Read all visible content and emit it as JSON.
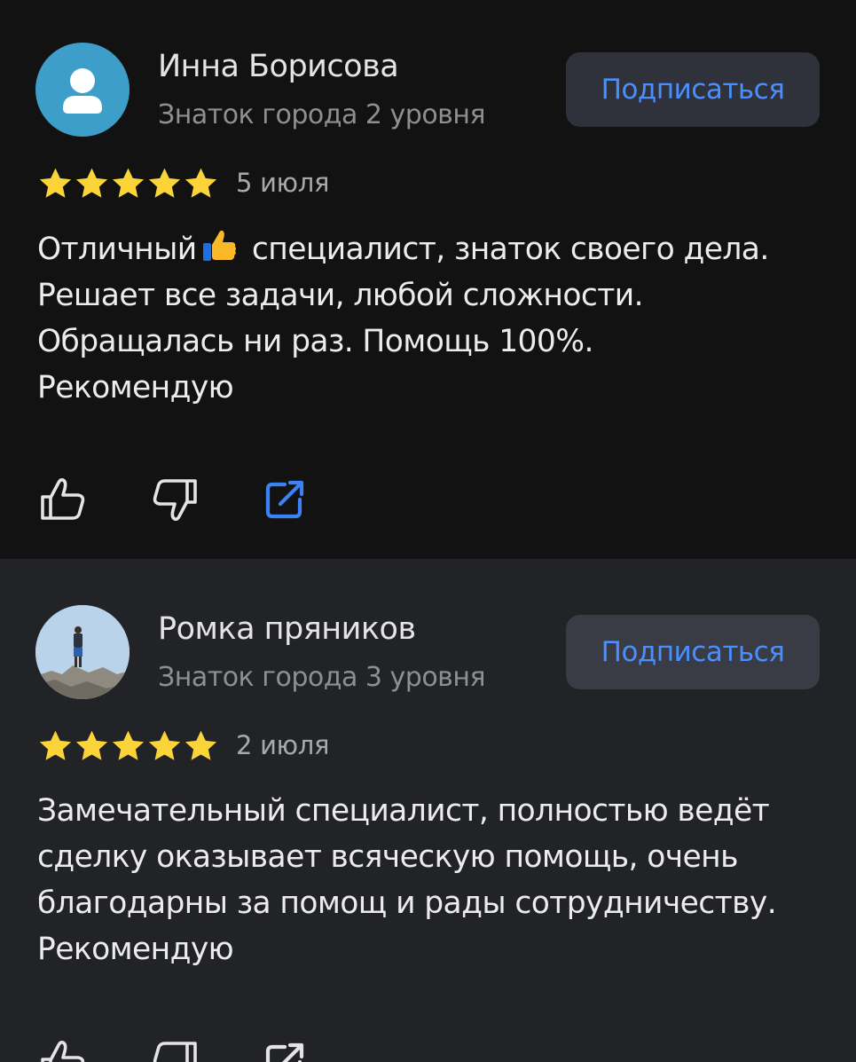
{
  "reviews": [
    {
      "author": "Инна Борисова",
      "level": "Знаток города 2 уровня",
      "subscribe_label": "Подписаться",
      "rating": 5,
      "date": "5 июля",
      "text_before_emoji": "Отличный",
      "emoji": "thumbs-up",
      "text_after_emoji": "специалист, знаток своего дела. Решает все задачи, любой сложности. Обращалась ни раз. Помощь 100%.",
      "text_line_2": "Рекомендую",
      "avatar": "user-silhouette-icon"
    },
    {
      "author": "Ромка пряников",
      "level": "Знаток города 3 уровня",
      "subscribe_label": "Подписаться",
      "rating": 5,
      "date": "2 июля",
      "text_main": "Замечательный специалист, полностью ведёт сделку оказывает всяческую помощь, очень благодарны за помощ и рады сотрудничеству.",
      "text_line_2": "Рекомендую",
      "avatar": "user-photo"
    }
  ],
  "actions": [
    "like-icon",
    "dislike-icon",
    "share-icon"
  ],
  "colors": {
    "background_1": "#121212",
    "background_2": "#222327",
    "accent": "#4a8fff",
    "star": "#fbd43a",
    "avatar_default": "#3d9fc9"
  }
}
